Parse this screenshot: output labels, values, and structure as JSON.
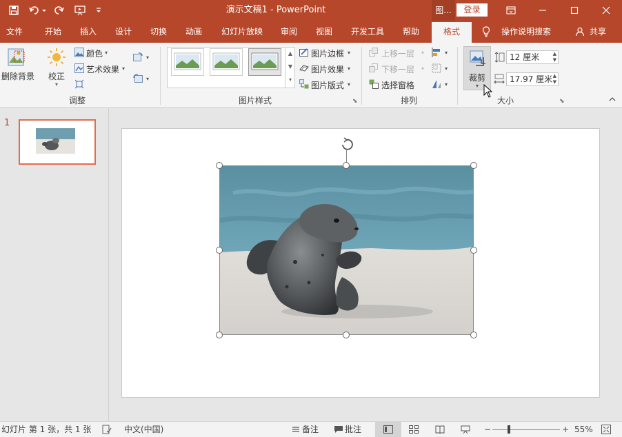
{
  "titlebar": {
    "doc_title": "演示文稿1  -  PowerPoint",
    "context_label": "图...",
    "login_label": "登录",
    "accent": "#b7472a"
  },
  "tabs": [
    "文件",
    "开始",
    "插入",
    "设计",
    "切换",
    "动画",
    "幻灯片放映",
    "审阅",
    "视图",
    "开发工具",
    "帮助",
    "格式"
  ],
  "active_tab": "格式",
  "tell_me": "操作说明搜索",
  "share": "共享",
  "ribbon": {
    "adjust": {
      "remove_bg": "删除背景",
      "correct": "校正",
      "color": "颜色",
      "artistic": "艺术效果",
      "label": "调整"
    },
    "styles": {
      "border": "图片边框",
      "effects": "图片效果",
      "layout": "图片版式",
      "label": "图片样式"
    },
    "arrange": {
      "forward": "上移一层",
      "backward": "下移一层",
      "selection_pane": "选择窗格",
      "label": "排列"
    },
    "size": {
      "crop": "裁剪",
      "height": "12 厘米",
      "width": "17.97 厘米",
      "label": "大小"
    }
  },
  "left_pane": {
    "slide_number": "1"
  },
  "status": {
    "slide_info": "幻灯片 第 1 张，共 1 张",
    "language": "中文(中国)",
    "notes": "备注",
    "comments": "批注",
    "zoom_minus": "−",
    "zoom_plus": "+",
    "zoom_value": "55%"
  },
  "icons": [
    "save-icon",
    "undo-icon",
    "redo-icon",
    "start-from-beginning-icon",
    "customize-qat-icon",
    "ribbon-display-icon",
    "minimize-icon",
    "maximize-icon",
    "close-icon",
    "lightbulb-icon",
    "user-icon",
    "rotate-handle-icon",
    "fit-slide-icon"
  ]
}
